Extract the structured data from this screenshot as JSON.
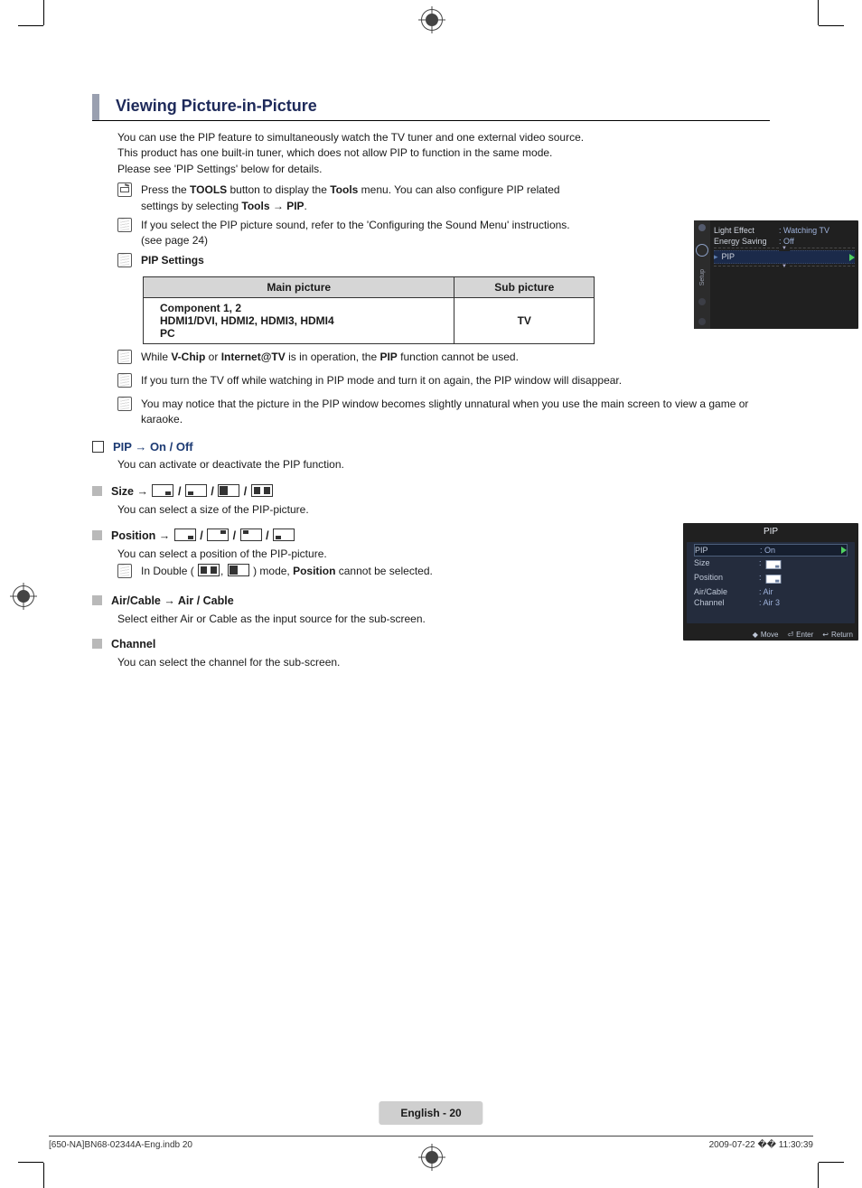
{
  "heading": "Viewing Picture-in-Picture",
  "intro": "You can use the PIP feature to simultaneously watch the TV tuner and one external video source. This product has one built-in tuner, which does not allow PIP to function in the same mode. Please see 'PIP Settings' below for details.",
  "tools_note_prefix": "Press the ",
  "tools_note_bold1": "TOOLS",
  "tools_note_mid": " button to display the ",
  "tools_note_bold2": "Tools",
  "tools_note_tail": " menu. You can also configure PIP related settings by selecting ",
  "tools_sel1": "Tools",
  "arrow": " → ",
  "tools_sel2": "PIP",
  "tools_sel_tail": ".",
  "note1": "If you select the PIP picture sound, refer to the 'Configuring the Sound Menu' instructions. (see page 24)",
  "pip_settings_label": "PIP Settings",
  "table": {
    "h1": "Main picture",
    "h2": "Sub picture",
    "r1": "Component 1, 2",
    "r2": "HDMI1/DVI, HDMI2, HDMI3, HDMI4",
    "r3": "PC",
    "sub": "TV"
  },
  "note2_pre": "While ",
  "note2_b1": "V-Chip",
  "note2_mid": " or ",
  "note2_b2": "Internet@TV",
  "note2_mid2": " is in operation, the ",
  "note2_b3": "PIP",
  "note2_tail": " function cannot be used.",
  "note3": "If you turn the TV off while watching in PIP mode and turn it on again, the PIP window will disappear.",
  "note4": "You may notice that the picture in the PIP window becomes slightly unnatural when you use the main screen to view a game or karaoke.",
  "sub1_title": "PIP → On / Off",
  "sub1_body": "You can activate or deactivate the PIP function.",
  "size_label": "Size → ",
  "size_body": "You can select a size of the PIP-picture.",
  "pos_label": "Position → ",
  "pos_body": "You can select a position of the PIP-picture.",
  "pos_note_pre": "In Double (",
  "pos_note_mid": ", ",
  "pos_note_post": ") mode, ",
  "pos_note_b": "Position",
  "pos_note_tail": " cannot be selected.",
  "aircable_label": "Air/Cable → Air / Cable",
  "aircable_body": "Select either Air or Cable as the input source for the sub-screen.",
  "channel_label": "Channel",
  "channel_body": "You can select the channel for the sub-screen.",
  "footer_pill": "English - 20",
  "footer_left": "[650-NA]BN68-02344A-Eng.indb   20",
  "footer_right": "2009-07-22   �� 11:30:39",
  "osd1": {
    "setup_label": "Setup",
    "r1l": "Light Effect",
    "r1v": ": Watching TV",
    "r2l": "Energy Saving",
    "r2v": ": Off",
    "r3l": "PIP",
    "r3v": ""
  },
  "osd2": {
    "title": "PIP",
    "r1l": "PIP",
    "r1v": ": On",
    "r2l": "Size",
    "r2v": ": ",
    "r3l": "Position",
    "r3v": ": ",
    "r4l": "Air/Cable",
    "r4v": ": Air",
    "r5l": "Channel",
    "r5v": ": Air 3",
    "f_move": "Move",
    "f_enter": "Enter",
    "f_return": "Return"
  }
}
